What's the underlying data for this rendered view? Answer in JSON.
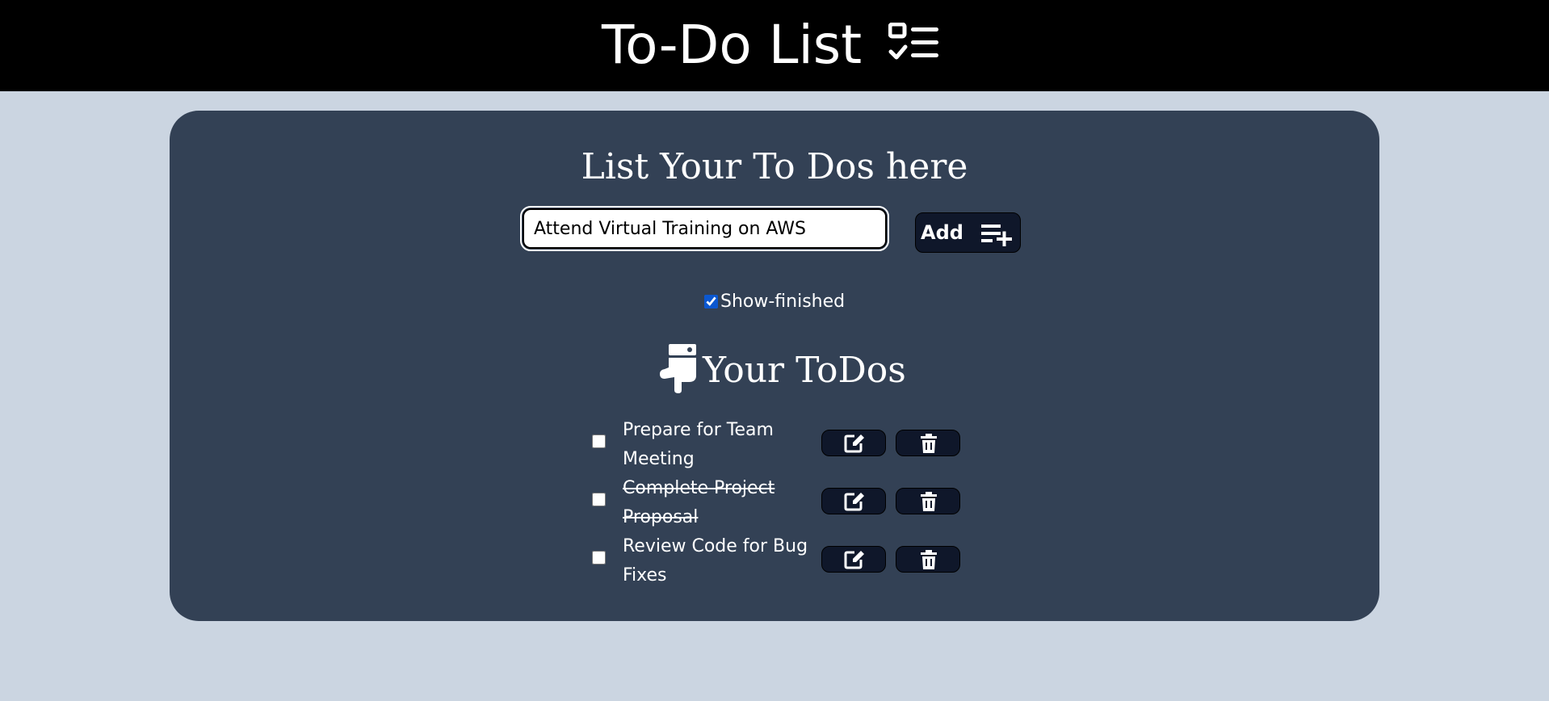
{
  "header": {
    "title": "To-Do List",
    "icon": "checklist-icon",
    "background": "#000000"
  },
  "main": {
    "heading": "List Your To Dos here",
    "input": {
      "value": "Attend Virtual Training on AWS",
      "placeholder": ""
    },
    "add_button": {
      "label": "Add",
      "icon": "playlist-add-icon"
    },
    "show_finished": {
      "label": "Show-finished",
      "checked": true
    },
    "list_heading": {
      "label": "Your ToDos",
      "icon": "hand-pointing-down-icon"
    },
    "todos": [
      {
        "text": "Prepare for Team Meeting",
        "finished": false
      },
      {
        "text": "Complete Project Proposal",
        "finished": true
      },
      {
        "text": "Review Code for Bug Fixes",
        "finished": false
      }
    ],
    "row_actions": {
      "edit_icon": "edit-icon",
      "delete_icon": "trash-icon"
    }
  },
  "colors": {
    "page_background": "#cbd5e1",
    "card_background": "#334155",
    "button_background": "#0f172a",
    "text": "#ffffff"
  }
}
